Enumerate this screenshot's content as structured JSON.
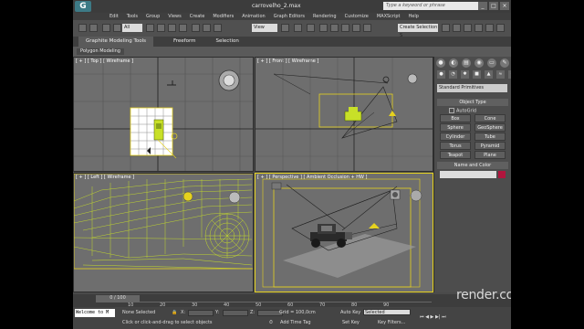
{
  "window": {
    "title": "carrovelho_2.max",
    "search_placeholder": "Type a keyword or phrase",
    "logo": "G",
    "buttons": [
      "_",
      "□",
      "×"
    ]
  },
  "menu": [
    "Edit",
    "Tools",
    "Group",
    "Views",
    "Create",
    "Modifiers",
    "Animation",
    "Graph Editors",
    "Rendering",
    "Customize",
    "MAXScript",
    "Help"
  ],
  "toolbar": {
    "selection_filter": "All",
    "coord_system": "View",
    "named_selection": "Create Selection S"
  },
  "ribbon": {
    "tabs": [
      "Graphite Modeling Tools",
      "Freeform",
      "Selection"
    ],
    "panel_label": "Polygon Modeling"
  },
  "viewports": {
    "top": "[ + ] [ Top ] [ Wireframe ]",
    "front": "[ + ] [ Front ] [ Wireframe ]",
    "left": "[ + ] [ Left ] [ Wireframe ]",
    "perspective": "[ + ] [ Perspective ] [ Ambient Occlusion + HW ]"
  },
  "command_panel": {
    "category": "Standard Primitives",
    "object_type_header": "Object Type",
    "autogrid": "AutoGrid",
    "buttons": [
      "Box",
      "Cone",
      "Sphere",
      "GeoSphere",
      "Cylinder",
      "Tube",
      "Torus",
      "Pyramid",
      "Teapot",
      "Plane"
    ],
    "name_color_header": "Name and Color",
    "swatch_color": "#b0153d"
  },
  "timeline": {
    "slider": "0 / 100",
    "ticks": [
      "10",
      "20",
      "30",
      "40",
      "50",
      "60",
      "70",
      "80",
      "90"
    ]
  },
  "status": {
    "maxscript": "Welcome to M",
    "selection": "None Selected",
    "prompt": "Click or click-and-drag to select objects",
    "x_label": "X:",
    "y_label": "Y:",
    "z_label": "Z:",
    "grid": "Grid = 100,0cm",
    "add_time_tag": "Add Time Tag",
    "auto_key": "Auto Key",
    "selected": "Selected",
    "set_key": "Set Key",
    "key_filters": "Key Filters..."
  },
  "watermark": "render.com.br",
  "colors": {
    "wire_yellow": "#c8e028",
    "selection_yellow": "#e6d21e",
    "viewport_bg": "#6e6e6e",
    "camera_dark": "#1e1e1e"
  }
}
